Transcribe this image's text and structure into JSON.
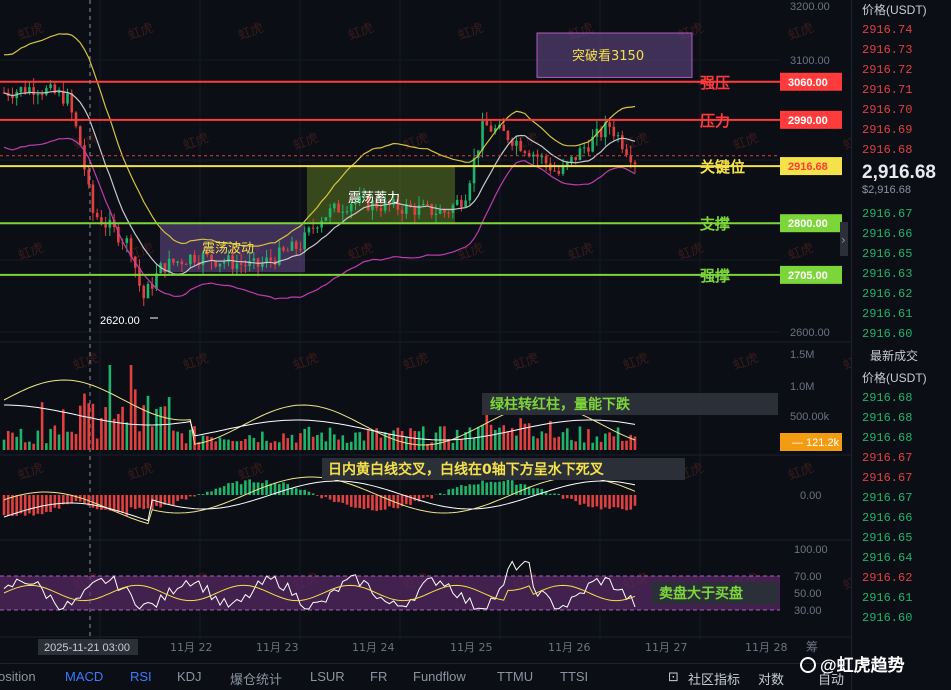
{
  "colors": {
    "up": "#1fb36b",
    "down": "#e04040",
    "resistance": "#ff3b3b",
    "key": "#f5e14a",
    "support": "#7cd63a",
    "upper_band": "#d6c43a",
    "lower_band": "#c03bb0",
    "mid_band": "#c8c8c8",
    "purple_zone": "#6a4c8c",
    "olive_zone": "#5d7a22",
    "macd_dif": "#f0e68c",
    "macd_dea": "#ffffff",
    "rsi_line": "#ffffff",
    "rsi_line2": "#f5e14a",
    "rsi_zone": "#5a2a66"
  },
  "chart_data": [
    {
      "type": "candlestick",
      "panel": "price",
      "y_axis_labels": [
        "3200.00",
        "3100.00",
        "2600.00"
      ],
      "ylim": [
        2600,
        3200
      ],
      "x_axis_labels": [
        "2025-11-21 03:00",
        "11月 22",
        "11月 23",
        "11月 24",
        "11月 25",
        "11月 26",
        "11月 27",
        "11月 28"
      ],
      "current_price": "2916.68",
      "low_marker": "2620.00",
      "levels": [
        {
          "label": "强压",
          "value": 3060,
          "price_tag": "3060.00",
          "color_key": "resistance"
        },
        {
          "label": "压力",
          "value": 2990,
          "price_tag": "2990.00",
          "color_key": "resistance"
        },
        {
          "label": "关键位",
          "value": 2905,
          "price_tag": "2916.68",
          "color_key": "key"
        },
        {
          "label": "支撑",
          "value": 2800,
          "price_tag": "2800.00",
          "color_key": "support"
        },
        {
          "label": "强撑",
          "value": 2705,
          "price_tag": "2705.00",
          "color_key": "support"
        }
      ],
      "zones": [
        {
          "label": "震荡波动",
          "y_top": 2800,
          "y_bottom": 2710,
          "color_key": "purple_zone"
        },
        {
          "label": "震荡蓄力",
          "y_top": 2905,
          "y_bottom": 2800,
          "color_key": "olive_zone"
        },
        {
          "label": "突破看3150",
          "y_top": 3150,
          "y_bottom": 3068,
          "color_key": "purple_zone"
        }
      ],
      "watermark_text": "虹虎"
    },
    {
      "type": "bar",
      "panel": "volume",
      "y_axis_labels": [
        "1.5M",
        "1.0M",
        "500.00k"
      ],
      "current_volume_tag": "121.2k",
      "annotation": "绿柱转红柱，量能下跌"
    },
    {
      "type": "histogram",
      "panel": "macd",
      "y_axis_labels": [
        "0.00"
      ],
      "annotation": "日内黄白线交叉，白线在0轴下方呈水下死叉"
    },
    {
      "type": "line",
      "panel": "rsi",
      "y_axis_labels": [
        "100.00",
        "70.00",
        "50.00",
        "30.00"
      ],
      "ylim": [
        0,
        100
      ],
      "annotation": "卖盘大于买盘"
    }
  ],
  "order_book": {
    "header_price": "价格(USDT)",
    "asks": [
      "2916.74",
      "2916.73",
      "2916.72",
      "2916.71",
      "2916.70",
      "2916.69",
      "2916.68"
    ],
    "last_price": "2,916.68",
    "last_price_usd": "$2,916.68",
    "bids": [
      "2916.67",
      "2916.66",
      "2916.65",
      "2916.63",
      "2916.62",
      "2916.61",
      "2916.60"
    ],
    "trades_title": "最新成交",
    "trades_header": "价格(USDT)",
    "trades": [
      {
        "price": "2916.68",
        "side": "buy"
      },
      {
        "price": "2916.68",
        "side": "buy"
      },
      {
        "price": "2916.68",
        "side": "buy"
      },
      {
        "price": "2916.67",
        "side": "sell"
      },
      {
        "price": "2916.67",
        "side": "sell"
      },
      {
        "price": "2916.67",
        "side": "buy"
      },
      {
        "price": "2916.66",
        "side": "buy"
      },
      {
        "price": "2916.65",
        "side": "buy"
      },
      {
        "price": "2916.64",
        "side": "buy"
      },
      {
        "price": "2916.62",
        "side": "sell"
      },
      {
        "price": "2916.61",
        "side": "buy"
      },
      {
        "price": "2916.60",
        "side": "buy"
      }
    ]
  },
  "bottom_tabs": [
    "osition",
    "MACD",
    "RSI",
    "KDJ",
    "爆仓统计",
    "LSUR",
    "FR",
    "Fundflow",
    "TTMU",
    "TTSI"
  ],
  "bottom_tools": [
    "社区指标",
    "对数",
    "自动"
  ],
  "side_label": "筹",
  "brand": "@虹虎趋势"
}
